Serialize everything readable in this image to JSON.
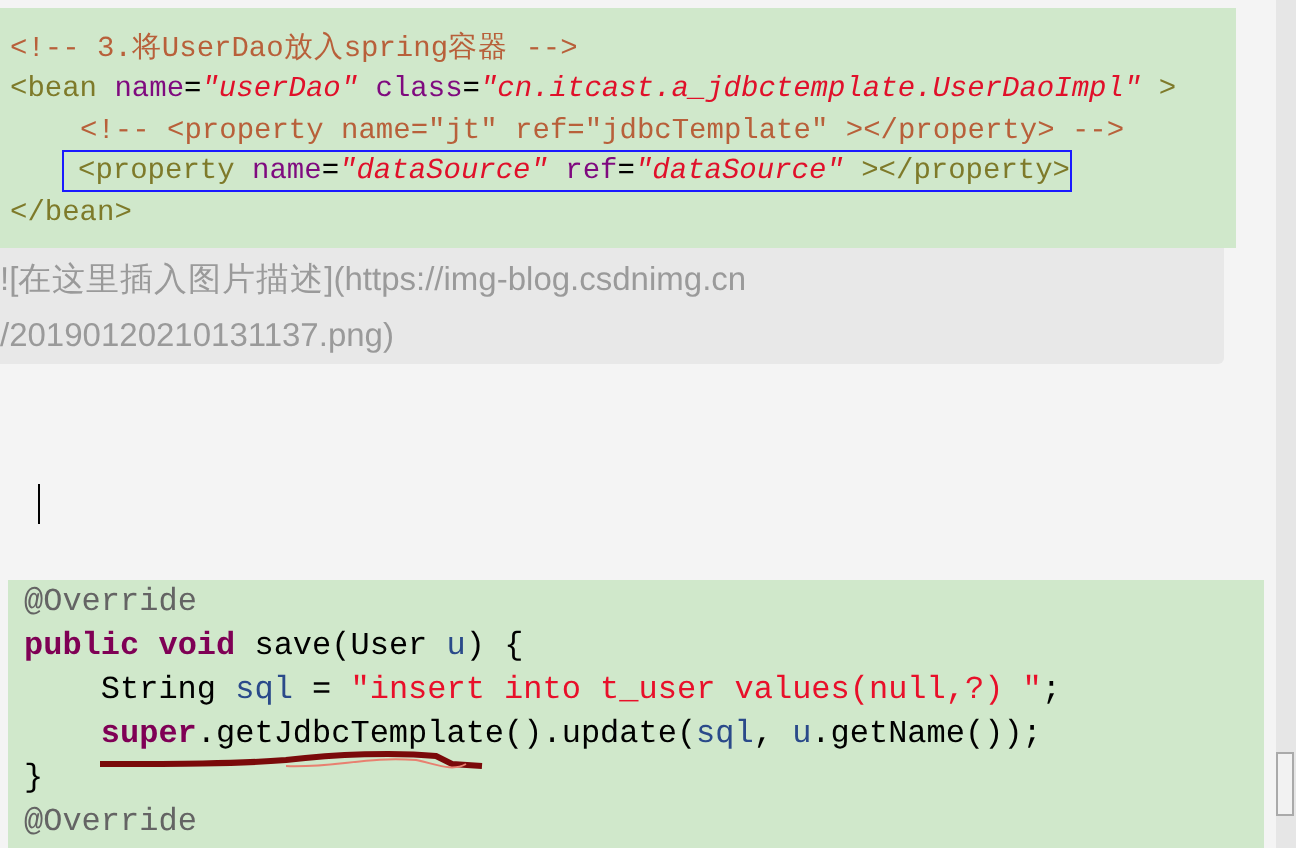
{
  "xml_block": {
    "lines": [
      {
        "indent": false,
        "boxed": false,
        "tokens": [
          {
            "text": "<!-- 3.将UserDao放入spring容器 -->",
            "kind": "comment"
          }
        ]
      },
      {
        "indent": false,
        "boxed": false,
        "tokens": [
          {
            "text": "<bean ",
            "kind": "tag"
          },
          {
            "text": "name",
            "kind": "attr"
          },
          {
            "text": "=",
            "kind": "plain"
          },
          {
            "text": "\"userDao\"",
            "kind": "value"
          },
          {
            "text": " class",
            "kind": "attr"
          },
          {
            "text": "=",
            "kind": "plain"
          },
          {
            "text": "\"cn.itcast.a_jdbctemplate.UserDaoImpl\"",
            "kind": "value"
          },
          {
            "text": " >",
            "kind": "tag"
          }
        ]
      },
      {
        "indent": true,
        "boxed": false,
        "tokens": [
          {
            "text": "<!-- <property name=\"jt\" ref=\"jdbcTemplate\" ></property> -->",
            "kind": "comment"
          }
        ]
      },
      {
        "indent": true,
        "boxed": true,
        "tokens": [
          {
            "text": "<property ",
            "kind": "tag"
          },
          {
            "text": "name",
            "kind": "attr"
          },
          {
            "text": "=",
            "kind": "plain"
          },
          {
            "text": "\"dataSource\"",
            "kind": "value"
          },
          {
            "text": " ref",
            "kind": "attr"
          },
          {
            "text": "=",
            "kind": "plain"
          },
          {
            "text": "\"dataSource\"",
            "kind": "value"
          },
          {
            "text": " ></property>",
            "kind": "tag"
          }
        ]
      },
      {
        "indent": false,
        "boxed": false,
        "tokens": [
          {
            "text": "</bean>",
            "kind": "tag"
          }
        ]
      }
    ]
  },
  "image_markdown": [
    "![在这里插入图片描述](https://img-blog.csdnimg.cn",
    "/20190120210131137.png)"
  ],
  "java_block": {
    "lines": [
      {
        "indent": false,
        "tokens": [
          {
            "text": "@Override",
            "kind": "annotation"
          }
        ]
      },
      {
        "indent": false,
        "tokens": [
          {
            "text": "public",
            "kind": "keyword"
          },
          {
            "text": " void",
            "kind": "keyword"
          },
          {
            "text": " save(User ",
            "kind": "plain"
          },
          {
            "text": "u",
            "kind": "var"
          },
          {
            "text": ") {",
            "kind": "plain"
          }
        ]
      },
      {
        "indent": true,
        "tokens": [
          {
            "text": "String ",
            "kind": "plain"
          },
          {
            "text": "sql",
            "kind": "var"
          },
          {
            "text": " = ",
            "kind": "plain"
          },
          {
            "text": "\"insert into t_user values(null,?) \"",
            "kind": "string"
          },
          {
            "text": ";",
            "kind": "plain"
          }
        ]
      },
      {
        "indent": true,
        "tokens": [
          {
            "text": "super",
            "kind": "keyword"
          },
          {
            "text": ".getJdbcTemplate().update(",
            "kind": "plain"
          },
          {
            "text": "sql",
            "kind": "var"
          },
          {
            "text": ", ",
            "kind": "plain"
          },
          {
            "text": "u",
            "kind": "var"
          },
          {
            "text": ".getName());",
            "kind": "plain"
          }
        ]
      },
      {
        "indent": false,
        "tokens": [
          {
            "text": "}",
            "kind": "plain"
          }
        ]
      },
      {
        "indent": false,
        "tokens": [
          {
            "text": "@Override",
            "kind": "annotation"
          }
        ]
      }
    ]
  }
}
